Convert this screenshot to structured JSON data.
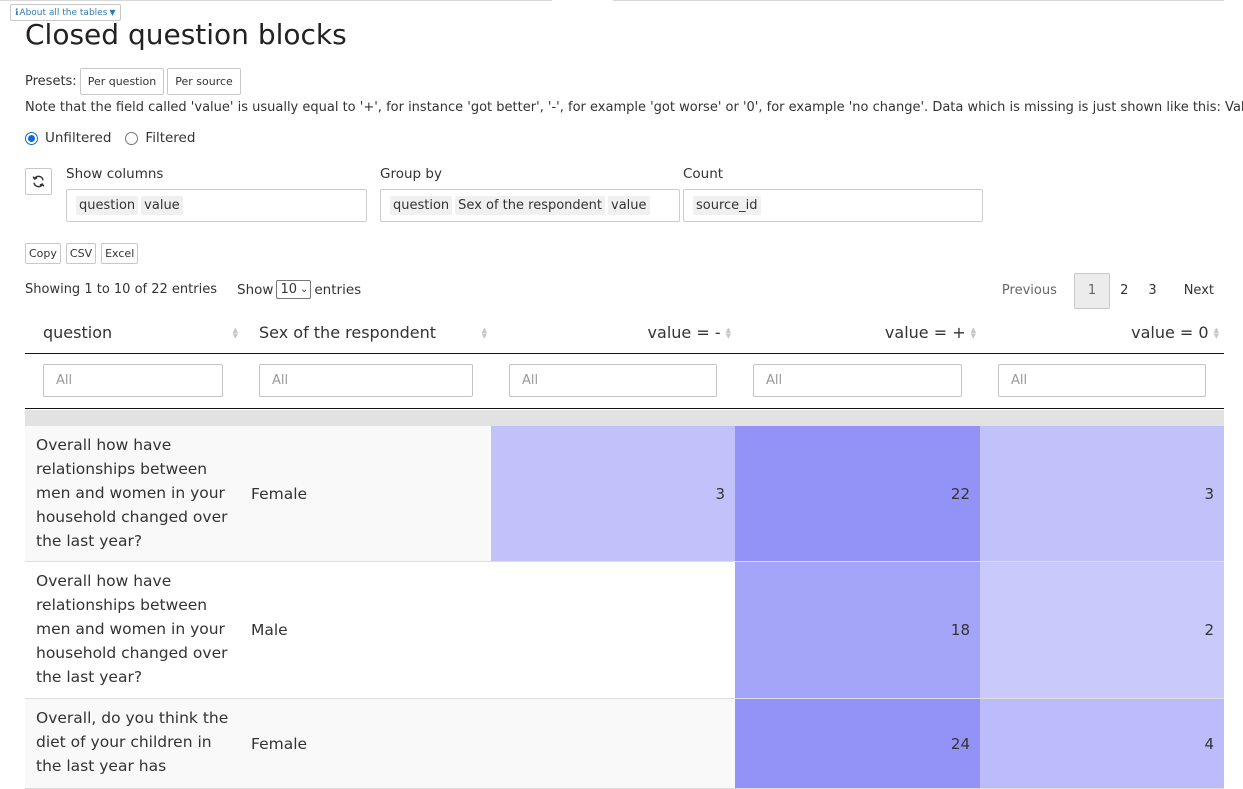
{
  "top": {
    "about_label": "About all the tables",
    "title": "Closed question blocks"
  },
  "presets": {
    "label": "Presets:",
    "buttons": [
      "Per question",
      "Per source"
    ]
  },
  "note": "Note that the field called 'value' is usually equal to '+', for instance 'got better', '-', for example 'got worse' or '0', for example 'no change'. Data which is missing is just shown like this: Value=''",
  "filter_mode": {
    "options": [
      "Unfiltered",
      "Filtered"
    ],
    "selected": "Unfiltered"
  },
  "controls": {
    "show_columns": {
      "label": "Show columns",
      "chips": [
        "question",
        "value"
      ]
    },
    "group_by": {
      "label": "Group by",
      "chips": [
        "question",
        "Sex of the respondent",
        "value"
      ]
    },
    "count": {
      "label": "Count",
      "chips": [
        "source_id"
      ]
    }
  },
  "exports": [
    "Copy",
    "CSV",
    "Excel"
  ],
  "table_info": {
    "showing": "Showing 1 to 10 of 22 entries",
    "show_label": "Show",
    "page_length": "10",
    "entries_label": "entries"
  },
  "pagination": {
    "previous": "Previous",
    "pages": [
      "1",
      "2",
      "3"
    ],
    "current": "1",
    "next": "Next"
  },
  "table": {
    "columns": [
      "question",
      "Sex of the respondent",
      "value = -",
      "value = +",
      "value = 0"
    ],
    "filter_placeholder": "All",
    "rows": [
      {
        "question": "Overall how have relationships between men and women in your household changed over the last year?",
        "sex": "Female",
        "minus": "3",
        "plus": "22",
        "zero": "3"
      },
      {
        "question": "Overall how have relationships between men and women in your household changed over the last year?",
        "sex": "Male",
        "minus": "",
        "plus": "18",
        "zero": "2"
      },
      {
        "question": "Overall, do you think the diet of your children in the last year has",
        "sex": "Female",
        "minus": "",
        "plus": "24",
        "zero": "4"
      }
    ],
    "cell_colors": {
      "r0_minus": "#c2c2fb",
      "r0_plus": "#9393f7",
      "r0_zero": "#c2c2fb",
      "r1_plus": "#a4a4f9",
      "r1_zero": "#c9c9fc",
      "r2_plus": "#9393f7",
      "r2_zero": "#bcbcfb"
    }
  }
}
